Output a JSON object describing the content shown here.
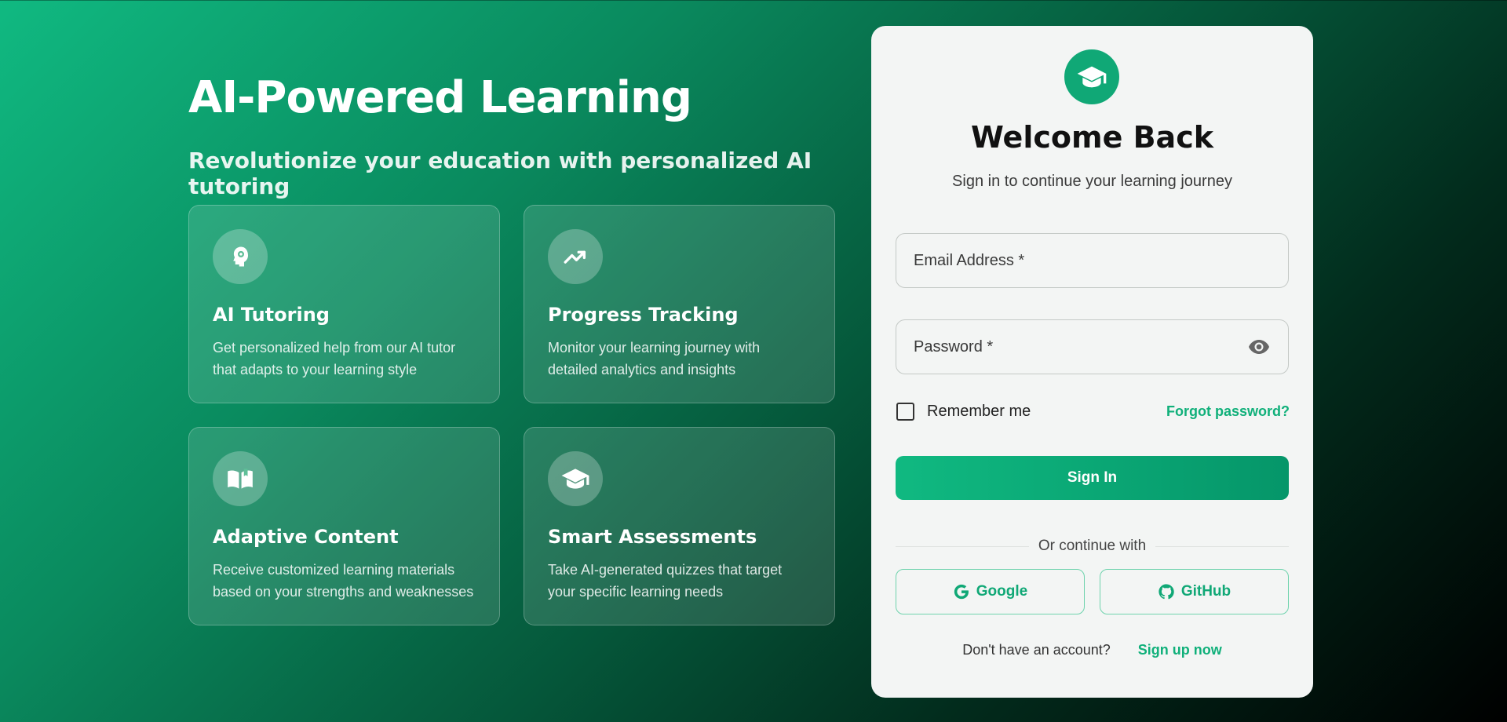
{
  "hero": {
    "title": "AI-Powered Learning",
    "subtitle": "Revolutionize your education with personalized AI tutoring"
  },
  "features": [
    {
      "icon": "brain-gear-icon",
      "title": "AI Tutoring",
      "description": "Get personalized help from our AI tutor that adapts to your learning style"
    },
    {
      "icon": "trending-up-icon",
      "title": "Progress Tracking",
      "description": "Monitor your learning journey with detailed analytics and insights"
    },
    {
      "icon": "open-book-icon",
      "title": "Adaptive Content",
      "description": "Receive customized learning materials based on your strengths and weaknesses"
    },
    {
      "icon": "graduation-cap-icon",
      "title": "Smart Assessments",
      "description": "Take AI-generated quizzes that target your specific learning needs"
    }
  ],
  "login": {
    "logo_icon": "graduation-cap-icon",
    "title": "Welcome Back",
    "subtitle": "Sign in to continue your learning journey",
    "email_placeholder": "Email Address *",
    "password_placeholder": "Password *",
    "remember_label": "Remember me",
    "remember_checked": false,
    "forgot_label": "Forgot password?",
    "signin_label": "Sign In",
    "divider_text": "Or continue with",
    "google_label": "Google",
    "github_label": "GitHub",
    "no_account_text": "Don't have an account?",
    "signup_label": "Sign up now"
  },
  "colors": {
    "accent": "#10b981",
    "accent_dark": "#059669",
    "card_bg": "#f3f5f4"
  }
}
